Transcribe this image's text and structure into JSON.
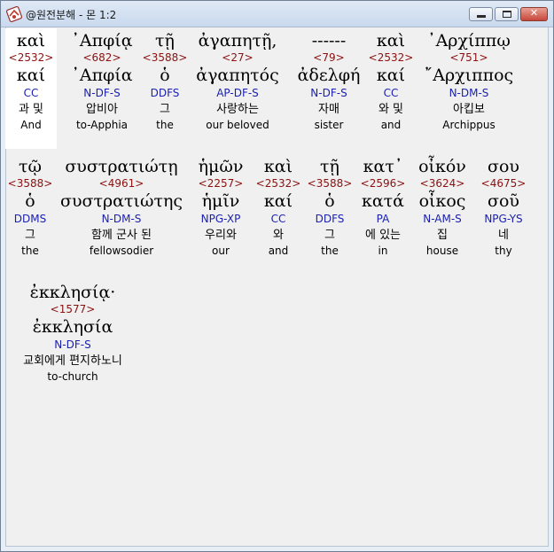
{
  "window": {
    "title": "@원전분해 - 몬 1:2",
    "minimize_glyph": "",
    "maximize_glyph": "",
    "close_glyph": "✕"
  },
  "words": [
    {
      "greek": "καὶ",
      "strong": "<2532>",
      "lemma": "καί",
      "parse": "CC",
      "korean": "과 및",
      "english": "And"
    },
    {
      "greek": "᾿Απφίᾳ",
      "strong": "<682>",
      "lemma": "᾿Απφία",
      "parse": "N-DF-S",
      "korean": "압비아",
      "english": "to-Apphia"
    },
    {
      "greek": "τῇ",
      "strong": "<3588>",
      "lemma": "ὁ",
      "parse": "DDFS",
      "korean": "그",
      "english": "the"
    },
    {
      "greek": "ἀγαπητῇ,",
      "strong": "<27>",
      "lemma": "ἀγαπητός",
      "parse": "AP-DF-S",
      "korean": "사랑하는",
      "english": "our beloved"
    },
    {
      "greek": "------",
      "strong": "<79>",
      "lemma": "ἀδελφή",
      "parse": "N-DF-S",
      "korean": "자매",
      "english": "sister"
    },
    {
      "greek": "καὶ",
      "strong": "<2532>",
      "lemma": "καί",
      "parse": "CC",
      "korean": "와 및",
      "english": "and"
    },
    {
      "greek": "᾿Αρχίππῳ",
      "strong": "<751>",
      "lemma": "῎Αρχιππος",
      "parse": "N-DM-S",
      "korean": "아킵보",
      "english": "Archippus"
    },
    {
      "greek": "τῷ",
      "strong": "<3588>",
      "lemma": "ὁ",
      "parse": "DDMS",
      "korean": "그",
      "english": "the"
    },
    {
      "greek": "συστρατιώτῃ",
      "strong": "<4961>",
      "lemma": "συστρατιώτης",
      "parse": "N-DM-S",
      "korean": "함께 군사 된",
      "english": "fellowsodier"
    },
    {
      "greek": "ἡμῶν",
      "strong": "<2257>",
      "lemma": "ἡμῖν",
      "parse": "NPG-XP",
      "korean": "우리와",
      "english": "our"
    },
    {
      "greek": "καὶ",
      "strong": "<2532>",
      "lemma": "καί",
      "parse": "CC",
      "korean": "와",
      "english": "and"
    },
    {
      "greek": "τῇ",
      "strong": "<3588>",
      "lemma": "ὁ",
      "parse": "DDFS",
      "korean": "그",
      "english": "the"
    },
    {
      "greek": "κατ᾿",
      "strong": "<2596>",
      "lemma": "κατά",
      "parse": "PA",
      "korean": "에 있는",
      "english": "in"
    },
    {
      "greek": "οἶκόν",
      "strong": "<3624>",
      "lemma": "οἶκος",
      "parse": "N-AM-S",
      "korean": "집",
      "english": "house"
    },
    {
      "greek": "σου",
      "strong": "<4675>",
      "lemma": "σοῦ",
      "parse": "NPG-YS",
      "korean": "네",
      "english": "thy"
    },
    {
      "greek": "ἐκκλησίᾳ·",
      "strong": "<1577>",
      "lemma": "ἐκκλησία",
      "parse": "N-DF-S",
      "korean": "교회에게 편지하노니",
      "english": "to-church"
    }
  ]
}
